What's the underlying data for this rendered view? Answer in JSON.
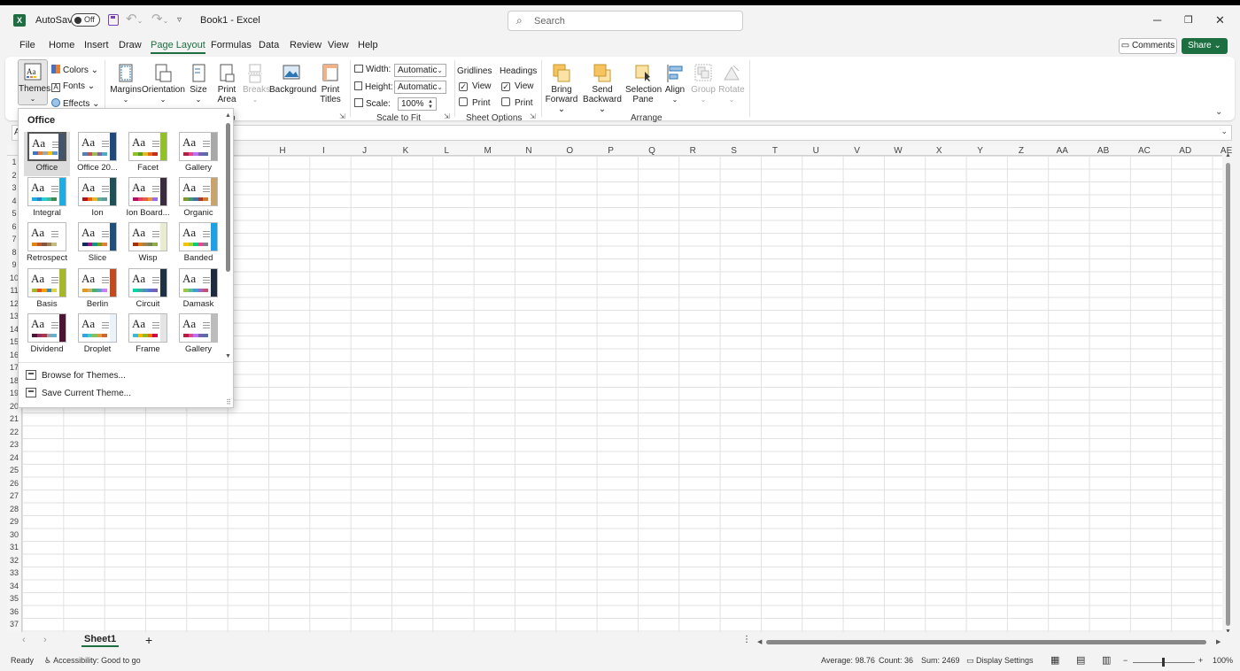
{
  "titlebar": {
    "app_icon": "X",
    "autosave_label": "AutoSave",
    "autosave_state": "Off",
    "doc_title": "Book1  -  Excel",
    "search_placeholder": "Search"
  },
  "tabs": [
    "File",
    "Home",
    "Insert",
    "Draw",
    "Page Layout",
    "Formulas",
    "Data",
    "Review",
    "View",
    "Help"
  ],
  "active_tab": "Page Layout",
  "header_buttons": {
    "comments": "Comments",
    "share": "Share"
  },
  "ribbon": {
    "themes": {
      "themes": "Themes",
      "colors": "Colors",
      "fonts": "Fonts",
      "effects": "Effects"
    },
    "page_setup": {
      "margins": "Margins",
      "orientation": "Orientation",
      "size": "Size",
      "print_area_1": "Print",
      "print_area_2": "Area",
      "breaks": "Breaks",
      "background": "Background",
      "print_titles_1": "Print",
      "print_titles_2": "Titles",
      "group_label_fragment": "p"
    },
    "scale_to_fit": {
      "width_label": "Width:",
      "width_value": "Automatic",
      "height_label": "Height:",
      "height_value": "Automatic",
      "scale_label": "Scale:",
      "scale_value": "100%",
      "group_label": "Scale to Fit"
    },
    "sheet_options": {
      "gridlines": "Gridlines",
      "headings": "Headings",
      "view": "View",
      "print": "Print",
      "group_label": "Sheet Options"
    },
    "arrange": {
      "bring_forward_1": "Bring",
      "bring_forward_2": "Forward",
      "send_backward_1": "Send",
      "send_backward_2": "Backward",
      "selection_pane_1": "Selection",
      "selection_pane_2": "Pane",
      "align": "Align",
      "group": "Group",
      "rotate": "Rotate",
      "group_label": "Arrange"
    }
  },
  "name_box": "A",
  "columns": [
    "H",
    "I",
    "J",
    "K",
    "L",
    "M",
    "N",
    "O",
    "P",
    "Q",
    "R",
    "S",
    "T",
    "U",
    "V",
    "W",
    "X",
    "Y",
    "Z",
    "AA",
    "AB",
    "AC",
    "AD",
    "AE"
  ],
  "rows": [
    "1",
    "2",
    "3",
    "4",
    "5",
    "6",
    "7",
    "8",
    "9",
    "10",
    "11",
    "12",
    "13",
    "14",
    "15",
    "16",
    "17",
    "18",
    "19",
    "20",
    "21",
    "22",
    "23",
    "24",
    "25",
    "26",
    "27",
    "28",
    "29",
    "30",
    "31",
    "32",
    "33",
    "34",
    "35",
    "36",
    "37"
  ],
  "themes_panel": {
    "heading": "Office",
    "themes": [
      {
        "name": "Office",
        "bar": "#44546a",
        "sw": [
          "#4472c4",
          "#ed7d31",
          "#a5a5a5",
          "#ffc000",
          "#5b9bd5"
        ]
      },
      {
        "name": "Office 20...",
        "bar": "#1f497d",
        "sw": [
          "#4f81bd",
          "#c0504d",
          "#9bbb59",
          "#8064a2",
          "#4bacc6"
        ]
      },
      {
        "name": "Facet",
        "bar": "#90c226",
        "sw": [
          "#90c226",
          "#54a021",
          "#e6b91e",
          "#e76618",
          "#c42f1a"
        ]
      },
      {
        "name": "Gallery",
        "bar": "#a8a8a8",
        "sw": [
          "#b71e42",
          "#de478e",
          "#bc72f0",
          "#795faf",
          "#586ea6"
        ]
      },
      {
        "name": "Integral",
        "bar": "#1cade4",
        "sw": [
          "#1cade4",
          "#2683c6",
          "#27ced7",
          "#42ba97",
          "#3e8853"
        ]
      },
      {
        "name": "Ion",
        "bar": "#1e5155",
        "sw": [
          "#b01513",
          "#ea6312",
          "#e6b729",
          "#6aac90",
          "#5f9c9d"
        ]
      },
      {
        "name": "Ion Board...",
        "bar": "#3b2b3e",
        "sw": [
          "#b31166",
          "#e33d6f",
          "#e45f3c",
          "#e9943a",
          "#9b6bf2"
        ]
      },
      {
        "name": "Organic",
        "bar": "#c9a36b",
        "sw": [
          "#83992a",
          "#3c9770",
          "#44709d",
          "#a23c33",
          "#d97828"
        ]
      },
      {
        "name": "Retrospect",
        "bar": "#ffffff",
        "sw": [
          "#e48312",
          "#bd582c",
          "#865640",
          "#9b8357",
          "#c2bc80"
        ]
      },
      {
        "name": "Slice",
        "bar": "#1e4e79",
        "sw": [
          "#052f61",
          "#a50e82",
          "#14967c",
          "#6a9e1f",
          "#e87d37"
        ]
      },
      {
        "name": "Wisp",
        "bar": "#eaeccf",
        "sw": [
          "#a53010",
          "#de7e18",
          "#9f8351",
          "#728653",
          "#92aa4c"
        ]
      },
      {
        "name": "Banded",
        "bar": "#1ba2e6",
        "sw": [
          "#ffc000",
          "#a5d028",
          "#08cc78",
          "#f24099",
          "#828288"
        ]
      },
      {
        "name": "Basis",
        "bar": "#a6b727",
        "sw": [
          "#a6b727",
          "#df5327",
          "#fe9e00",
          "#418ab3",
          "#d7d447"
        ]
      },
      {
        "name": "Berlin",
        "bar": "#c3491e",
        "sw": [
          "#f09415",
          "#c1b56b",
          "#4baf73",
          "#5aa6c0",
          "#d17df9"
        ]
      },
      {
        "name": "Circuit",
        "bar": "#1c3144",
        "sw": [
          "#03d4a8",
          "#39aea5",
          "#5090b8",
          "#5971d1",
          "#7361b9"
        ]
      },
      {
        "name": "Damask",
        "bar": "#1e2a3f",
        "sw": [
          "#9ec544",
          "#50bea3",
          "#4a9ccc",
          "#9a66ca",
          "#c54f71"
        ]
      },
      {
        "name": "Dividend",
        "bar": "#4d1434",
        "sw": [
          "#4d1434",
          "#903163",
          "#b2324b",
          "#969fa7",
          "#66b1ce"
        ]
      },
      {
        "name": "Droplet",
        "bar": "#e9f3f9",
        "sw": [
          "#2fa3ee",
          "#4bcaad",
          "#86c157",
          "#d99c3f",
          "#ce6633"
        ]
      },
      {
        "name": "Frame",
        "bar": "#e4e4e4",
        "sw": [
          "#40bad2",
          "#fab900",
          "#90bb23",
          "#ee7008",
          "#d0004b"
        ]
      },
      {
        "name": "Gallery",
        "bar": "#bcbcbc",
        "sw": [
          "#b71e42",
          "#de478e",
          "#bc72f0",
          "#795faf",
          "#586ea6"
        ]
      }
    ],
    "browse": "Browse for Themes...",
    "save": "Save Current Theme..."
  },
  "sheet_tabs": {
    "active": "Sheet1",
    "add": "+"
  },
  "status": {
    "ready": "Ready",
    "accessibility": "Accessibility: Good to go",
    "average": "Average: 98.76",
    "count": "Count: 36",
    "sum": "Sum: 2469",
    "display_settings": "Display Settings",
    "zoom": "100%",
    "zoom_minus": "−",
    "zoom_plus": "+"
  },
  "colors": {
    "excel_green": "#1d6f42",
    "grid": "#e1e1e1",
    "ribbon_bg": "#ffffff",
    "chrome_bg": "#f3f3f3"
  },
  "icons": [
    "excel-logo",
    "save-icon",
    "undo-icon",
    "redo-icon",
    "search-icon",
    "minimize-icon",
    "restore-icon",
    "close-icon"
  ]
}
